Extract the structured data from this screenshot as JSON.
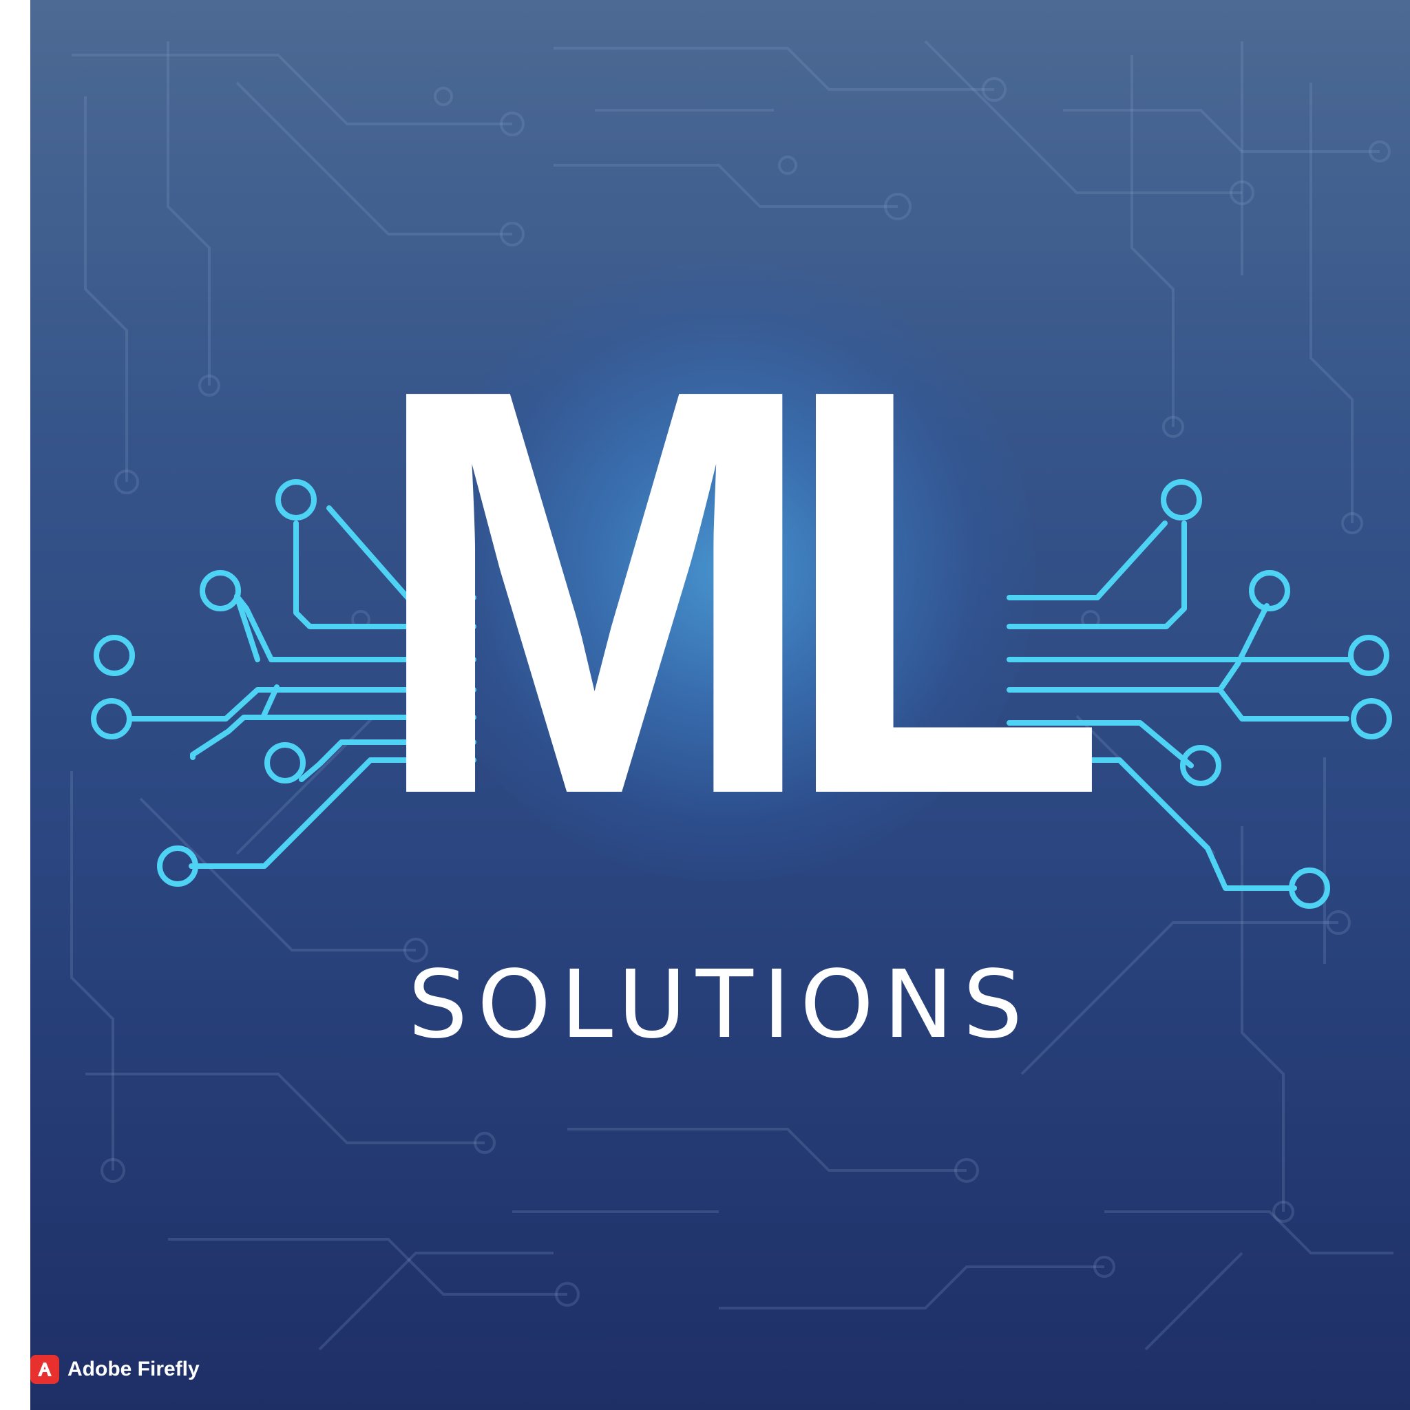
{
  "logo": {
    "monogram": "ML",
    "tagline": "SOLUTIONS"
  },
  "watermark": {
    "label": "Adobe Firefly"
  },
  "colors": {
    "background_top": "#4d6a94",
    "background_bottom": "#1e2f66",
    "circuit_accent": "#4fd3f5",
    "text": "#ffffff",
    "badge": "#e8312f"
  },
  "icons": {
    "left_wing": "circuit-traces-icon",
    "right_wing": "circuit-traces-icon",
    "badge": "adobe-logo-icon"
  }
}
